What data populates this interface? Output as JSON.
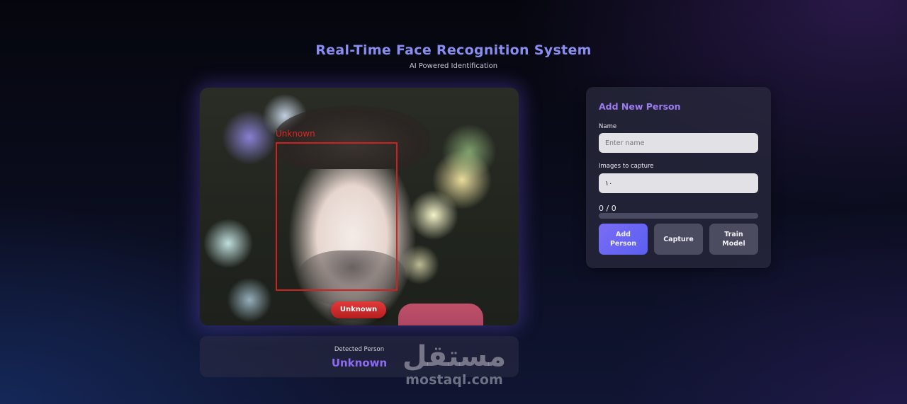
{
  "header": {
    "title": "Real-Time Face Recognition System",
    "subtitle": "AI Powered Identification"
  },
  "video": {
    "face_box_label": "Unknown",
    "status_pill": "Unknown"
  },
  "detected": {
    "label": "Detected Person",
    "value": "Unknown"
  },
  "add_person": {
    "title": "Add New Person",
    "name_label": "Name",
    "name_placeholder": "Enter name",
    "name_value": "",
    "images_label": "Images to capture",
    "images_value": "١٠",
    "progress_text": "0 / 0",
    "progress_fraction": 0,
    "buttons": {
      "add": "Add Person",
      "capture": "Capture",
      "train": "Train Model"
    }
  },
  "watermark": {
    "arabic": "مستقل",
    "latin": "mostaql.com"
  },
  "colors": {
    "accent": "#8d6bf2",
    "title": "#8a8df0",
    "alert": "#d12020"
  }
}
